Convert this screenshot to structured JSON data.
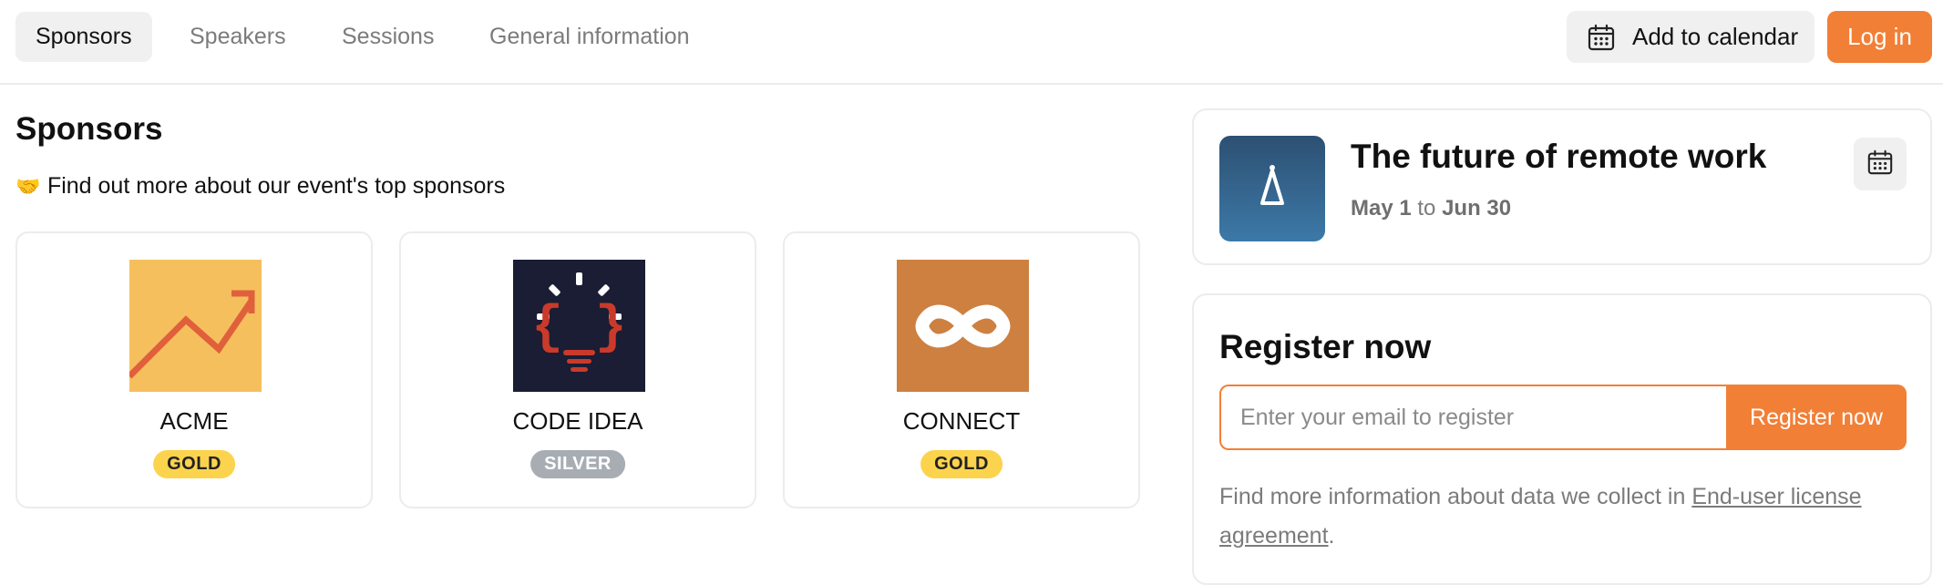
{
  "topnav": {
    "tabs": [
      {
        "label": "Sponsors",
        "active": true
      },
      {
        "label": "Speakers",
        "active": false
      },
      {
        "label": "Sessions",
        "active": false
      },
      {
        "label": "General information",
        "active": false
      }
    ],
    "add_to_calendar_label": "Add to calendar",
    "calendar_icon": "calendar-icon",
    "login_label": "Log in"
  },
  "sponsors": {
    "title": "Sponsors",
    "subtitle_emoji": "🤝",
    "subtitle": "Find out more about our event's top sponsors",
    "items": [
      {
        "name": "ACME",
        "tier": "GOLD",
        "logo_icon": "trending-up-icon"
      },
      {
        "name": "CODE IDEA",
        "tier": "SILVER",
        "logo_icon": "lightbulb-code-icon"
      },
      {
        "name": "CONNECT",
        "tier": "GOLD",
        "logo_icon": "infinity-icon"
      }
    ]
  },
  "event": {
    "title": "The future of remote work",
    "date_start": "May 1",
    "date_sep": "to",
    "date_end": "Jun 30",
    "logo_icon": "party-hat-icon"
  },
  "register": {
    "title": "Register now",
    "email_placeholder": "Enter your email to register",
    "button_label": "Register now",
    "info_text": "Find more information about data we collect in ",
    "link_text": "End-user license agreement",
    "info_suffix": "."
  },
  "colors": {
    "accent": "#f27f36",
    "gold_badge": "#fcd34d",
    "silver_badge": "#a8adb4",
    "acme_bg": "#f6bf5e",
    "code_idea_bg": "#1a1d33",
    "connect_bg": "#cd8040"
  }
}
